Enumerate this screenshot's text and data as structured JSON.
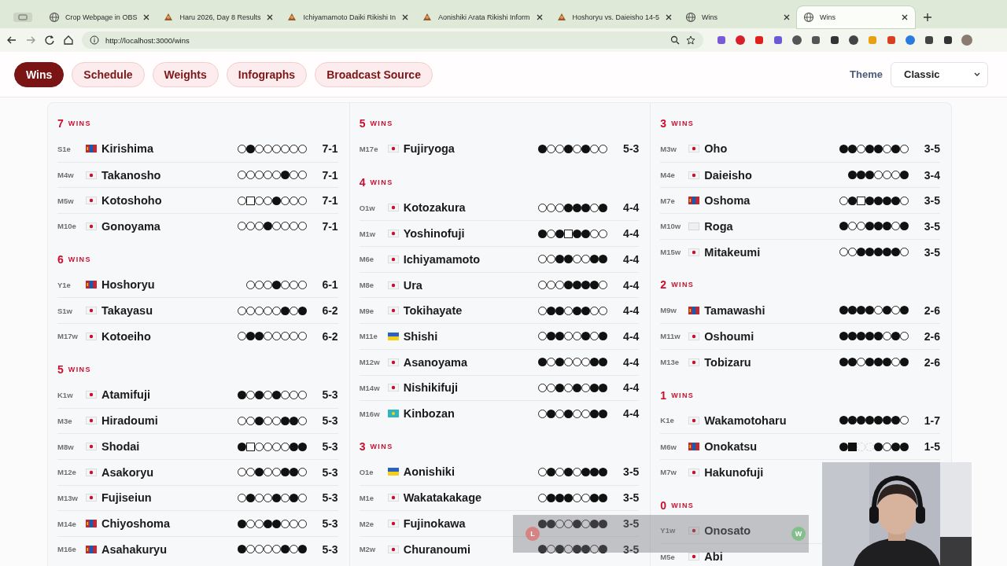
{
  "browser": {
    "tabs": [
      {
        "title": "Crop Webpage in OBS",
        "selected": false
      },
      {
        "title": "Haru 2026, Day 8 Results",
        "selected": false
      },
      {
        "title": "Ichiyamamoto Daiki Rikishi In",
        "selected": false
      },
      {
        "title": "Aonishiki Arata Rikishi Inform",
        "selected": false
      },
      {
        "title": "Hoshoryu vs. Daieisho 14-5",
        "selected": false
      },
      {
        "title": "Wins",
        "selected": false
      },
      {
        "title": "Wins",
        "selected": true
      }
    ],
    "url": "http://localhost:3000/wins"
  },
  "nav": {
    "items": [
      {
        "label": "Wins",
        "selected": true
      },
      {
        "label": "Schedule",
        "selected": false
      },
      {
        "label": "Weights",
        "selected": false
      },
      {
        "label": "Infographs",
        "selected": false
      },
      {
        "label": "Broadcast Source",
        "selected": false
      }
    ]
  },
  "theme": {
    "label": "Theme",
    "value": "Classic"
  },
  "columns": [
    {
      "groups": [
        {
          "count": "7",
          "unit": "WINS",
          "rows": [
            {
              "rank": "S1e",
              "kind": "mongolia",
              "name": "Kirishima",
              "results": [
                {
                  "kind": "win"
                },
                {
                  "kind": "loss"
                },
                {
                  "kind": "win"
                },
                {
                  "kind": "win"
                },
                {
                  "kind": "win"
                },
                {
                  "kind": "win"
                },
                {
                  "kind": "win"
                },
                {
                  "kind": "win"
                }
              ],
              "record": "7-1"
            },
            {
              "rank": "M4w",
              "kind": "japan",
              "name": "Takanosho",
              "results": [
                {
                  "kind": "win"
                },
                {
                  "kind": "win"
                },
                {
                  "kind": "win"
                },
                {
                  "kind": "win"
                },
                {
                  "kind": "win"
                },
                {
                  "kind": "loss"
                },
                {
                  "kind": "win"
                },
                {
                  "kind": "win"
                }
              ],
              "record": "7-1"
            },
            {
              "rank": "M5w",
              "kind": "japan",
              "name": "Kotoshoho",
              "results": [
                {
                  "kind": "win"
                },
                {
                  "kind": "fwin"
                },
                {
                  "kind": "win"
                },
                {
                  "kind": "win"
                },
                {
                  "kind": "loss"
                },
                {
                  "kind": "win"
                },
                {
                  "kind": "win"
                },
                {
                  "kind": "win"
                }
              ],
              "record": "7-1"
            },
            {
              "rank": "M10e",
              "kind": "japan",
              "name": "Gonoyama",
              "results": [
                {
                  "kind": "win"
                },
                {
                  "kind": "win"
                },
                {
                  "kind": "win"
                },
                {
                  "kind": "loss"
                },
                {
                  "kind": "win"
                },
                {
                  "kind": "win"
                },
                {
                  "kind": "win"
                },
                {
                  "kind": "win"
                }
              ],
              "record": "7-1"
            }
          ]
        },
        {
          "count": "6",
          "unit": "WINS",
          "rows": [
            {
              "rank": "Y1e",
              "kind": "mongolia",
              "name": "Hoshoryu",
              "results": [
                {
                  "kind": "win"
                },
                {
                  "kind": "win"
                },
                {
                  "kind": "win"
                },
                {
                  "kind": "loss"
                },
                {
                  "kind": "win"
                },
                {
                  "kind": "win"
                },
                {
                  "kind": "win"
                }
              ],
              "record": "6-1"
            },
            {
              "rank": "S1w",
              "kind": "japan",
              "name": "Takayasu",
              "results": [
                {
                  "kind": "win"
                },
                {
                  "kind": "win"
                },
                {
                  "kind": "win"
                },
                {
                  "kind": "win"
                },
                {
                  "kind": "win"
                },
                {
                  "kind": "loss"
                },
                {
                  "kind": "win"
                },
                {
                  "kind": "loss"
                }
              ],
              "record": "6-2"
            },
            {
              "rank": "M17w",
              "kind": "japan",
              "name": "Kotoeiho",
              "results": [
                {
                  "kind": "win"
                },
                {
                  "kind": "loss"
                },
                {
                  "kind": "loss"
                },
                {
                  "kind": "win"
                },
                {
                  "kind": "win"
                },
                {
                  "kind": "win"
                },
                {
                  "kind": "win"
                },
                {
                  "kind": "win"
                }
              ],
              "record": "6-2"
            }
          ]
        },
        {
          "count": "5",
          "unit": "WINS",
          "rows": [
            {
              "rank": "K1w",
              "kind": "japan",
              "name": "Atamifuji",
              "results": [
                {
                  "kind": "loss"
                },
                {
                  "kind": "win"
                },
                {
                  "kind": "loss"
                },
                {
                  "kind": "win"
                },
                {
                  "kind": "loss"
                },
                {
                  "kind": "win"
                },
                {
                  "kind": "win"
                },
                {
                  "kind": "win"
                }
              ],
              "record": "5-3"
            },
            {
              "rank": "M3e",
              "kind": "japan",
              "name": "Hiradoumi",
              "results": [
                {
                  "kind": "win"
                },
                {
                  "kind": "win"
                },
                {
                  "kind": "loss"
                },
                {
                  "kind": "win"
                },
                {
                  "kind": "win"
                },
                {
                  "kind": "loss"
                },
                {
                  "kind": "loss"
                },
                {
                  "kind": "win"
                }
              ],
              "record": "5-3"
            },
            {
              "rank": "M8w",
              "kind": "japan",
              "name": "Shodai",
              "results": [
                {
                  "kind": "loss"
                },
                {
                  "kind": "fwin"
                },
                {
                  "kind": "win"
                },
                {
                  "kind": "win"
                },
                {
                  "kind": "win"
                },
                {
                  "kind": "win"
                },
                {
                  "kind": "loss"
                },
                {
                  "kind": "loss"
                }
              ],
              "record": "5-3"
            },
            {
              "rank": "M12e",
              "kind": "japan",
              "name": "Asakoryu",
              "results": [
                {
                  "kind": "win"
                },
                {
                  "kind": "win"
                },
                {
                  "kind": "loss"
                },
                {
                  "kind": "win"
                },
                {
                  "kind": "win"
                },
                {
                  "kind": "loss"
                },
                {
                  "kind": "loss"
                },
                {
                  "kind": "win"
                }
              ],
              "record": "5-3"
            },
            {
              "rank": "M13w",
              "kind": "japan",
              "name": "Fujiseiun",
              "results": [
                {
                  "kind": "win"
                },
                {
                  "kind": "loss"
                },
                {
                  "kind": "win"
                },
                {
                  "kind": "win"
                },
                {
                  "kind": "loss"
                },
                {
                  "kind": "win"
                },
                {
                  "kind": "loss"
                },
                {
                  "kind": "win"
                }
              ],
              "record": "5-3"
            },
            {
              "rank": "M14e",
              "kind": "mongolia",
              "name": "Chiyoshoma",
              "results": [
                {
                  "kind": "loss"
                },
                {
                  "kind": "win"
                },
                {
                  "kind": "win"
                },
                {
                  "kind": "loss"
                },
                {
                  "kind": "loss"
                },
                {
                  "kind": "win"
                },
                {
                  "kind": "win"
                },
                {
                  "kind": "win"
                }
              ],
              "record": "5-3"
            },
            {
              "rank": "M16e",
              "kind": "mongolia",
              "name": "Asahakuryu",
              "results": [
                {
                  "kind": "loss"
                },
                {
                  "kind": "win"
                },
                {
                  "kind": "win"
                },
                {
                  "kind": "win"
                },
                {
                  "kind": "win"
                },
                {
                  "kind": "loss"
                },
                {
                  "kind": "win"
                },
                {
                  "kind": "loss"
                }
              ],
              "record": "5-3"
            }
          ]
        }
      ]
    },
    {
      "groups": [
        {
          "count": "5",
          "unit": "WINS",
          "rows": [
            {
              "rank": "M17e",
              "kind": "japan",
              "name": "Fujiryoga",
              "results": [
                {
                  "kind": "loss"
                },
                {
                  "kind": "win"
                },
                {
                  "kind": "win"
                },
                {
                  "kind": "loss"
                },
                {
                  "kind": "win"
                },
                {
                  "kind": "loss"
                },
                {
                  "kind": "win"
                },
                {
                  "kind": "win"
                }
              ],
              "record": "5-3"
            }
          ]
        },
        {
          "count": "4",
          "unit": "WINS",
          "rows": [
            {
              "rank": "O1w",
              "kind": "japan",
              "name": "Kotozakura",
              "results": [
                {
                  "kind": "win"
                },
                {
                  "kind": "win"
                },
                {
                  "kind": "win"
                },
                {
                  "kind": "loss"
                },
                {
                  "kind": "loss"
                },
                {
                  "kind": "loss"
                },
                {
                  "kind": "win"
                },
                {
                  "kind": "loss"
                }
              ],
              "record": "4-4"
            },
            {
              "rank": "M1w",
              "kind": "japan",
              "name": "Yoshinofuji",
              "results": [
                {
                  "kind": "loss"
                },
                {
                  "kind": "win"
                },
                {
                  "kind": "loss"
                },
                {
                  "kind": "fwin"
                },
                {
                  "kind": "loss"
                },
                {
                  "kind": "loss"
                },
                {
                  "kind": "win"
                },
                {
                  "kind": "win"
                }
              ],
              "record": "4-4"
            },
            {
              "rank": "M6e",
              "kind": "japan",
              "name": "Ichiyamamoto",
              "results": [
                {
                  "kind": "win"
                },
                {
                  "kind": "win"
                },
                {
                  "kind": "loss"
                },
                {
                  "kind": "loss"
                },
                {
                  "kind": "win"
                },
                {
                  "kind": "win"
                },
                {
                  "kind": "loss"
                },
                {
                  "kind": "loss"
                }
              ],
              "record": "4-4"
            },
            {
              "rank": "M8e",
              "kind": "japan",
              "name": "Ura",
              "results": [
                {
                  "kind": "win"
                },
                {
                  "kind": "win"
                },
                {
                  "kind": "win"
                },
                {
                  "kind": "loss"
                },
                {
                  "kind": "loss"
                },
                {
                  "kind": "loss"
                },
                {
                  "kind": "loss"
                },
                {
                  "kind": "win"
                }
              ],
              "record": "4-4"
            },
            {
              "rank": "M9e",
              "kind": "japan",
              "name": "Tokihayate",
              "results": [
                {
                  "kind": "win"
                },
                {
                  "kind": "loss"
                },
                {
                  "kind": "loss"
                },
                {
                  "kind": "win"
                },
                {
                  "kind": "loss"
                },
                {
                  "kind": "loss"
                },
                {
                  "kind": "win"
                },
                {
                  "kind": "win"
                }
              ],
              "record": "4-4"
            },
            {
              "rank": "M11e",
              "kind": "ukraine",
              "name": "Shishi",
              "results": [
                {
                  "kind": "win"
                },
                {
                  "kind": "loss"
                },
                {
                  "kind": "loss"
                },
                {
                  "kind": "win"
                },
                {
                  "kind": "win"
                },
                {
                  "kind": "loss"
                },
                {
                  "kind": "win"
                },
                {
                  "kind": "loss"
                }
              ],
              "record": "4-4"
            },
            {
              "rank": "M12w",
              "kind": "japan",
              "name": "Asanoyama",
              "results": [
                {
                  "kind": "loss"
                },
                {
                  "kind": "win"
                },
                {
                  "kind": "loss"
                },
                {
                  "kind": "win"
                },
                {
                  "kind": "win"
                },
                {
                  "kind": "win"
                },
                {
                  "kind": "loss"
                },
                {
                  "kind": "loss"
                }
              ],
              "record": "4-4"
            },
            {
              "rank": "M14w",
              "kind": "japan",
              "name": "Nishikifuji",
              "results": [
                {
                  "kind": "win"
                },
                {
                  "kind": "win"
                },
                {
                  "kind": "loss"
                },
                {
                  "kind": "win"
                },
                {
                  "kind": "loss"
                },
                {
                  "kind": "win"
                },
                {
                  "kind": "loss"
                },
                {
                  "kind": "loss"
                }
              ],
              "record": "4-4"
            },
            {
              "rank": "M16w",
              "kind": "kazakhstan",
              "name": "Kinbozan",
              "results": [
                {
                  "kind": "win"
                },
                {
                  "kind": "loss"
                },
                {
                  "kind": "win"
                },
                {
                  "kind": "loss"
                },
                {
                  "kind": "win"
                },
                {
                  "kind": "win"
                },
                {
                  "kind": "loss"
                },
                {
                  "kind": "loss"
                }
              ],
              "record": "4-4"
            }
          ]
        },
        {
          "count": "3",
          "unit": "WINS",
          "rows": [
            {
              "rank": "O1e",
              "kind": "ukraine",
              "name": "Aonishiki",
              "results": [
                {
                  "kind": "win"
                },
                {
                  "kind": "loss"
                },
                {
                  "kind": "win"
                },
                {
                  "kind": "loss"
                },
                {
                  "kind": "win"
                },
                {
                  "kind": "loss"
                },
                {
                  "kind": "loss"
                },
                {
                  "kind": "loss"
                }
              ],
              "record": "3-5"
            },
            {
              "rank": "M1e",
              "kind": "japan",
              "name": "Wakatakakage",
              "results": [
                {
                  "kind": "win"
                },
                {
                  "kind": "loss"
                },
                {
                  "kind": "loss"
                },
                {
                  "kind": "loss"
                },
                {
                  "kind": "win"
                },
                {
                  "kind": "win"
                },
                {
                  "kind": "loss"
                },
                {
                  "kind": "loss"
                }
              ],
              "record": "3-5"
            },
            {
              "rank": "M2e",
              "kind": "japan",
              "name": "Fujinokawa",
              "results": [
                {
                  "kind": "loss"
                },
                {
                  "kind": "loss"
                },
                {
                  "kind": "win"
                },
                {
                  "kind": "win"
                },
                {
                  "kind": "loss"
                },
                {
                  "kind": "win"
                },
                {
                  "kind": "loss"
                },
                {
                  "kind": "loss"
                }
              ],
              "record": "3-5"
            },
            {
              "rank": "M2w",
              "kind": "japan",
              "name": "Churanoumi",
              "results": [
                {
                  "kind": "loss"
                },
                {
                  "kind": "win"
                },
                {
                  "kind": "loss"
                },
                {
                  "kind": "win"
                },
                {
                  "kind": "loss"
                },
                {
                  "kind": "loss"
                },
                {
                  "kind": "win"
                },
                {
                  "kind": "loss"
                }
              ],
              "record": "3-5"
            }
          ]
        }
      ]
    },
    {
      "groups": [
        {
          "count": "3",
          "unit": "WINS",
          "rows": [
            {
              "rank": "M3w",
              "kind": "japan",
              "name": "Oho",
              "results": [
                {
                  "kind": "loss"
                },
                {
                  "kind": "loss"
                },
                {
                  "kind": "win"
                },
                {
                  "kind": "loss"
                },
                {
                  "kind": "loss"
                },
                {
                  "kind": "win"
                },
                {
                  "kind": "loss"
                },
                {
                  "kind": "win"
                }
              ],
              "record": "3-5"
            },
            {
              "rank": "M4e",
              "kind": "japan",
              "name": "Daieisho",
              "results": [
                {
                  "kind": "loss"
                },
                {
                  "kind": "loss"
                },
                {
                  "kind": "loss"
                },
                {
                  "kind": "win"
                },
                {
                  "kind": "win"
                },
                {
                  "kind": "win"
                },
                {
                  "kind": "loss"
                }
              ],
              "record": "3-4"
            },
            {
              "rank": "M7e",
              "kind": "mongolia",
              "name": "Oshoma",
              "results": [
                {
                  "kind": "win"
                },
                {
                  "kind": "loss"
                },
                {
                  "kind": "fwin"
                },
                {
                  "kind": "loss"
                },
                {
                  "kind": "loss"
                },
                {
                  "kind": "loss"
                },
                {
                  "kind": "loss"
                },
                {
                  "kind": "win"
                }
              ],
              "record": "3-5"
            },
            {
              "rank": "M10w",
              "kind": "blank",
              "name": "Roga",
              "results": [
                {
                  "kind": "loss"
                },
                {
                  "kind": "win"
                },
                {
                  "kind": "win"
                },
                {
                  "kind": "loss"
                },
                {
                  "kind": "loss"
                },
                {
                  "kind": "loss"
                },
                {
                  "kind": "win"
                },
                {
                  "kind": "loss"
                }
              ],
              "record": "3-5"
            },
            {
              "rank": "M15w",
              "kind": "japan",
              "name": "Mitakeumi",
              "results": [
                {
                  "kind": "win"
                },
                {
                  "kind": "win"
                },
                {
                  "kind": "loss"
                },
                {
                  "kind": "loss"
                },
                {
                  "kind": "loss"
                },
                {
                  "kind": "loss"
                },
                {
                  "kind": "loss"
                },
                {
                  "kind": "win"
                }
              ],
              "record": "3-5"
            }
          ]
        },
        {
          "count": "2",
          "unit": "WINS",
          "rows": [
            {
              "rank": "M9w",
              "kind": "mongolia",
              "name": "Tamawashi",
              "results": [
                {
                  "kind": "loss"
                },
                {
                  "kind": "loss"
                },
                {
                  "kind": "loss"
                },
                {
                  "kind": "loss"
                },
                {
                  "kind": "win"
                },
                {
                  "kind": "loss"
                },
                {
                  "kind": "win"
                },
                {
                  "kind": "loss"
                }
              ],
              "record": "2-6"
            },
            {
              "rank": "M11w",
              "kind": "japan",
              "name": "Oshoumi",
              "results": [
                {
                  "kind": "loss"
                },
                {
                  "kind": "loss"
                },
                {
                  "kind": "loss"
                },
                {
                  "kind": "loss"
                },
                {
                  "kind": "loss"
                },
                {
                  "kind": "win"
                },
                {
                  "kind": "loss"
                },
                {
                  "kind": "win"
                }
              ],
              "record": "2-6"
            },
            {
              "rank": "M13e",
              "kind": "japan",
              "name": "Tobizaru",
              "results": [
                {
                  "kind": "loss"
                },
                {
                  "kind": "loss"
                },
                {
                  "kind": "win"
                },
                {
                  "kind": "loss"
                },
                {
                  "kind": "loss"
                },
                {
                  "kind": "loss"
                },
                {
                  "kind": "win"
                },
                {
                  "kind": "loss"
                }
              ],
              "record": "2-6"
            }
          ]
        },
        {
          "count": "1",
          "unit": "WINS",
          "rows": [
            {
              "rank": "K1e",
              "kind": "japan",
              "name": "Wakamotoharu",
              "results": [
                {
                  "kind": "loss"
                },
                {
                  "kind": "loss"
                },
                {
                  "kind": "loss"
                },
                {
                  "kind": "loss"
                },
                {
                  "kind": "loss"
                },
                {
                  "kind": "loss"
                },
                {
                  "kind": "loss"
                },
                {
                  "kind": "win"
                }
              ],
              "record": "1-7"
            },
            {
              "rank": "M6w",
              "kind": "mongolia",
              "name": "Onokatsu",
              "results": [
                {
                  "kind": "loss"
                },
                {
                  "kind": "floss"
                },
                {
                  "kind": "absent"
                },
                {
                  "kind": "absent"
                },
                {
                  "kind": "loss"
                },
                {
                  "kind": "win"
                },
                {
                  "kind": "loss"
                },
                {
                  "kind": "loss"
                }
              ],
              "record": "1-5"
            },
            {
              "rank": "M7w",
              "kind": "japan",
              "name": "Hakunofuji"
            }
          ]
        },
        {
          "count": "0",
          "unit": "WINS",
          "rows": [
            {
              "rank": "Y1w",
              "kind": "japan",
              "name": "Onosato"
            },
            {
              "rank": "M5e",
              "kind": "japan",
              "name": "Abi"
            }
          ]
        }
      ]
    }
  ],
  "overlay": {
    "left_badge": "L",
    "right_badge": "W"
  }
}
